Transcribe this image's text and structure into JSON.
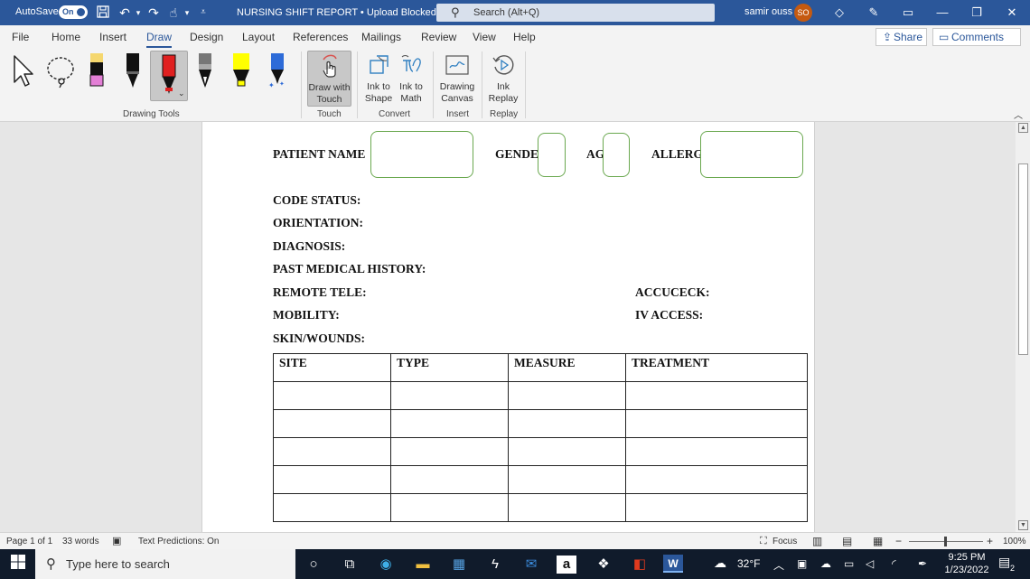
{
  "titlebar": {
    "autosave_label": "AutoSave",
    "autosave_state": "On",
    "document_title": "NURSING SHIFT REPORT • Upload Blocked",
    "search_placeholder": "Search (Alt+Q)",
    "user_name": "samir ouss",
    "user_initials": "SO"
  },
  "menu": {
    "tabs": [
      "File",
      "Home",
      "Insert",
      "Draw",
      "Design",
      "Layout",
      "References",
      "Mailings",
      "Review",
      "View",
      "Help"
    ],
    "active_tab": "Draw",
    "share_label": "Share",
    "comments_label": "Comments"
  },
  "ribbon": {
    "groups": {
      "drawing_tools": "Drawing Tools",
      "touch": "Touch",
      "convert": "Convert",
      "insert": "Insert",
      "replay": "Replay"
    },
    "buttons": {
      "draw_with_touch": [
        "Draw with",
        "Touch"
      ],
      "ink_to_shape": [
        "Ink to",
        "Shape"
      ],
      "ink_to_math": [
        "Ink to",
        "Math"
      ],
      "drawing_canvas": [
        "Drawing",
        "Canvas"
      ],
      "ink_replay": [
        "Ink",
        "Replay"
      ]
    }
  },
  "document": {
    "header_fields": {
      "patient_name": "PATIENT NAME",
      "gender": "GENDE",
      "age": "AG",
      "allergies": "ALLERG"
    },
    "left_fields": [
      "CODE STATUS:",
      "ORIENTATION:",
      "DIAGNOSIS:",
      "PAST MEDICAL HISTORY:",
      "REMOTE TELE:",
      "MOBILITY:",
      "SKIN/WOUNDS:"
    ],
    "right_fields": [
      "ACCUCECK:",
      "IV ACCESS:"
    ],
    "table": {
      "headers": [
        "SITE",
        "TYPE",
        "MEASURE",
        "TREATMENT"
      ],
      "empty_rows": 5
    }
  },
  "statusbar": {
    "page": "Page 1 of 1",
    "words": "33 words",
    "text_predictions": "Text Predictions: On",
    "focus": "Focus",
    "zoom": "100%"
  },
  "taskbar": {
    "search_placeholder": "Type here to search",
    "temperature": "32°F",
    "time": "9:25 PM",
    "date": "1/23/2022",
    "notification_count": "2"
  },
  "colors": {
    "word_blue": "#2b579a",
    "shape_outline": "#6aa84f",
    "taskbar": "#101b2b"
  }
}
